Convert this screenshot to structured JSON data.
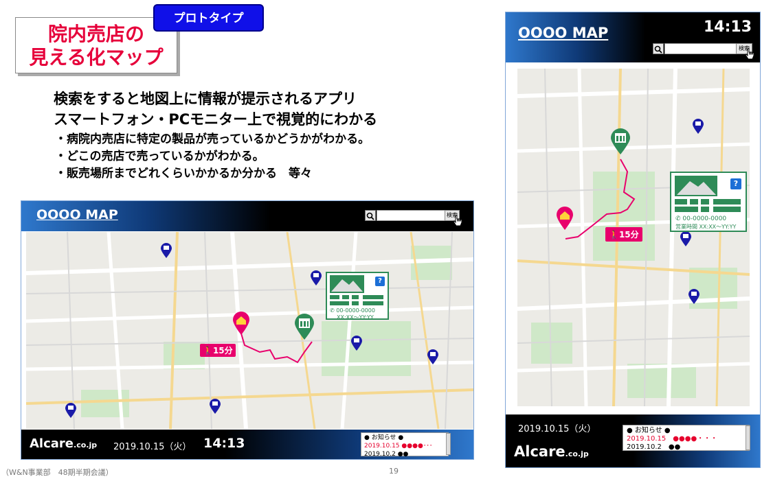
{
  "badge": {
    "label": "プロトタイプ"
  },
  "title": {
    "line1": "院内売店の",
    "line2": "見える化マップ"
  },
  "headlines": [
    "検索をすると地図上に情報が提示されるアプリ",
    "スマートフォン・PCモニター上で視覚的にわかる"
  ],
  "bullets": [
    "・病院内売店に特定の製品が売っているかどうかがわかる。",
    "・どこの売店で売っているかがわかる。",
    "・販売場所までどれくらいかかるか分かる　等々"
  ],
  "pc": {
    "map_title": "OOOO MAP",
    "search_button": "検索",
    "brand": "Alcare",
    "brand_suffix": ".co.jp",
    "date": "2019.10.15（火）",
    "time": "14:13",
    "walk": "15分",
    "phone": "00-0000-0000",
    "hours": "XX:XX〜YY:YY",
    "news_header": "● お知らせ ●",
    "news": [
      {
        "date": "2019.10.15",
        "marks": "●●●●･･･"
      },
      {
        "date": "2019.10.2",
        "marks": "●●"
      }
    ]
  },
  "sp": {
    "map_title": "OOOO MAP",
    "time": "14:13",
    "search_button": "検索",
    "walk": "15分",
    "phone": "00-0000-0000",
    "hours_label": "営業時間",
    "hours": "XX:XX〜YY:YY",
    "date": "2019.10.15（火）",
    "brand": "Alcare",
    "brand_suffix": ".co.jp",
    "news_header": "● お知らせ ●",
    "news": [
      {
        "date": "2019.10.15",
        "marks": "●●●●・・・"
      },
      {
        "date": "2019.10.2",
        "marks": "●●"
      }
    ]
  },
  "footer": {
    "left": "（W&N事業部　48期半期会議）",
    "page": "19"
  },
  "colors": {
    "accent_red": "#e6003a",
    "badge_blue": "#1010e8",
    "route_pink": "#e8006c",
    "store_green": "#2e8b57",
    "pin_blue": "#1a1aa8"
  }
}
